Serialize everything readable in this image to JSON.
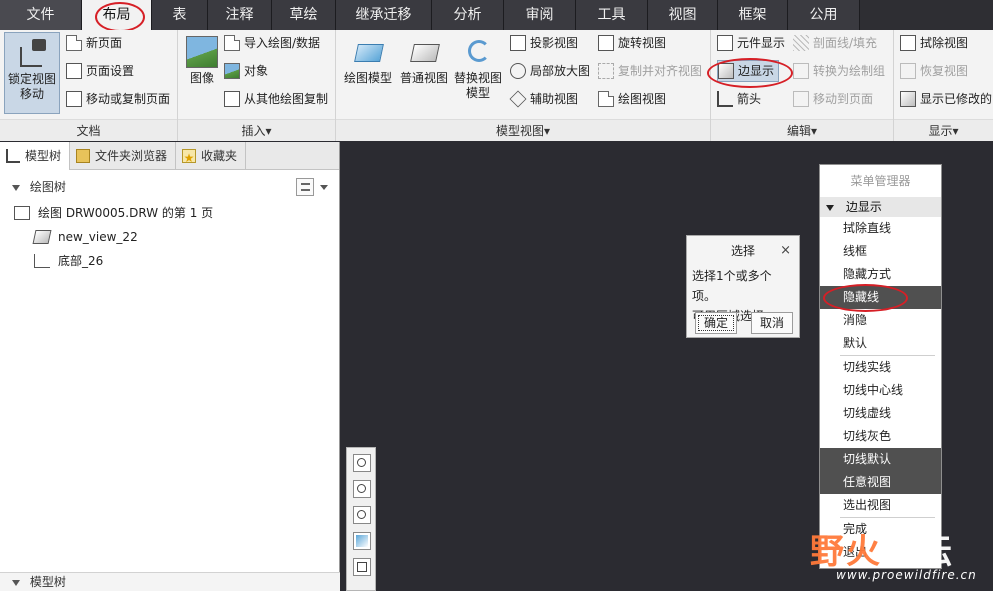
{
  "tabs": [
    {
      "label": "文件",
      "w": 0
    },
    {
      "label": "布局"
    },
    {
      "label": "表"
    },
    {
      "label": "注释"
    },
    {
      "label": "草绘"
    },
    {
      "label": "继承迁移"
    },
    {
      "label": "分析"
    },
    {
      "label": "审阅"
    },
    {
      "label": "工具"
    },
    {
      "label": "视图"
    },
    {
      "label": "框架"
    },
    {
      "label": "公用"
    }
  ],
  "ribbon": {
    "doc": {
      "lock_view": "锁定视图移动",
      "new_page": "新页面",
      "page_setup": "页面设置",
      "move_copy_page": "移动或复制页面",
      "label": "文档"
    },
    "insert": {
      "image": "图像",
      "import_drawing": "导入绘图/数据",
      "object": "对象",
      "copy_from_other": "从其他绘图复制",
      "label": "插入▾"
    },
    "model_views": {
      "drawing_model": "绘图模型",
      "general_view": "普通视图",
      "replace_view_model": "替换视图模型",
      "projection_view": "投影视图",
      "detailed_view": "局部放大图",
      "auxiliary_view": "辅助视图",
      "revolved_view": "旋转视图",
      "copy_align_view": "复制并对齐视图",
      "drawing_view": "绘图视图",
      "label": "模型视图▾"
    },
    "edit": {
      "element_display": "元件显示",
      "xhatch": "剖面线/填充",
      "edge_display": "边显示",
      "convert_group": "转换为绘制组",
      "arrow": "箭头",
      "move_to_page": "移动到页面",
      "label": "编辑▾"
    },
    "display": {
      "erase_view": "拭除视图",
      "resume_view": "恢复视图",
      "show_modified": "显示已修改的",
      "label": "显示▾"
    }
  },
  "panel": {
    "tabs": [
      "模型树",
      "文件夹浏览器",
      "收藏夹"
    ],
    "tree_header": "绘图树",
    "rows": [
      "绘图 DRW0005.DRW 的第 1 页",
      "new_view_22",
      "底部_26"
    ],
    "bottom_header": "模型树"
  },
  "dialog": {
    "title": "选择",
    "close": "×",
    "line1": "选择1个或多个项。",
    "line2": "可用区域选择。",
    "ok": "确定",
    "cancel": "取消"
  },
  "menu": {
    "title": "菜单管理器",
    "section": "边显示",
    "items": [
      "拭除直线",
      "线框",
      "隐藏方式",
      "隐藏线",
      "消隐",
      "默认",
      "切线实线",
      "切线中心线",
      "切线虚线",
      "切线灰色",
      "切线默认",
      "任意视图",
      "选出视图",
      "完成",
      "退出"
    ]
  },
  "watermark": {
    "part1": "野",
    "part2": "火",
    "part3": "论坛",
    "url": "www.proewildfire.cn"
  },
  "colors": {
    "highlight": "#d61f26",
    "selected_menu": "#505050",
    "canvas": "#2b2b31"
  }
}
